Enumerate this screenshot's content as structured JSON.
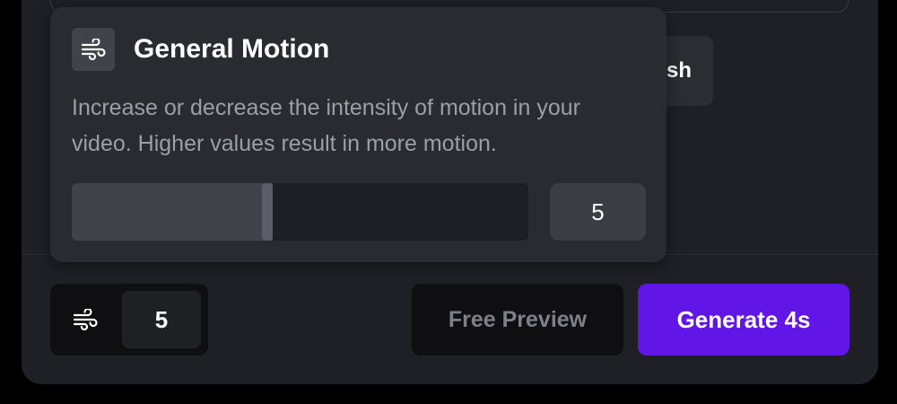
{
  "background_panel": {
    "partial_button_label": "sh"
  },
  "popover": {
    "icon": "wind-icon",
    "title": "General Motion",
    "description": "Increase or decrease the intensity of motion in your video. Higher values result in more motion.",
    "slider": {
      "value": 5,
      "min": 0,
      "max": 10,
      "fill_fraction": 0.44
    },
    "value_display": "5"
  },
  "toolbar": {
    "motion_icon": "wind-icon",
    "motion_value": "5",
    "free_preview_label": "Free Preview",
    "generate_label": "Generate 4s"
  },
  "colors": {
    "accent": "#6115e6",
    "panel": "#1f2025",
    "popover": "#2a2b30"
  }
}
